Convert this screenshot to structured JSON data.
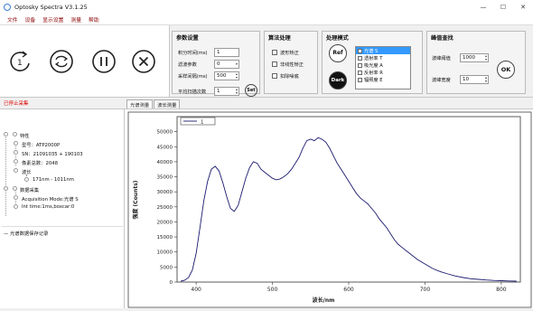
{
  "window": {
    "title": "Optosky Spectra V3.1.25",
    "minimize": "—",
    "maximize": "☐",
    "close": "✕"
  },
  "menu": [
    "文件",
    "设备",
    "显示设置",
    "测量",
    "帮助"
  ],
  "toolbar": {
    "buttons": [
      "single-measure",
      "continuous-measure",
      "pause",
      "stop"
    ]
  },
  "params": {
    "title": "参数设置",
    "integration_label": "积分时间(ms)",
    "integration_value": "1",
    "filter_label": "滤波参数",
    "filter_value": "0",
    "interval_label": "采样间隔(ms)",
    "interval_value": "500",
    "avg_label": "平均扫描次数",
    "avg_value": "1",
    "set_label": "Set"
  },
  "algo": {
    "title": "算法处理",
    "options": [
      "波形矫正",
      "非线性矫正",
      "扣除噪底"
    ]
  },
  "mode": {
    "title": "处理模式",
    "ref_label": "Ref",
    "dark_label": "Dark",
    "items": [
      "光谱 S",
      "透射率 T",
      "吸光度 A",
      "反射率 R",
      "辐照度 E"
    ]
  },
  "peak": {
    "title": "峰值查找",
    "threshold_label": "波峰阈值",
    "threshold_value": "1000",
    "width_label": "波峰宽度",
    "width_value": "10",
    "ok_label": "OK"
  },
  "status": {
    "stopped": "已停止采集"
  },
  "tree": {
    "attr": "特性",
    "model": "型号：ATP2000P",
    "sn": "SN：21091035 + 190103",
    "pixels": "像素总数：2048",
    "wavelength": "波长",
    "range": "171nm - 1011nm",
    "acq": "数据采集",
    "acq_mode": "Acquisition Mode:光谱 S",
    "int_time": "Int time:1ms,boxcar:0",
    "save": "光谱数据保存记录"
  },
  "tabs": [
    "光谱测量",
    "波长测量"
  ],
  "chart_data": {
    "type": "line",
    "legend": [
      "1"
    ],
    "xlabel": "波长/nm",
    "ylabel": "强度 (Counts)",
    "xlim": [
      375,
      825
    ],
    "ylim": [
      0,
      55000
    ],
    "xticks": [
      400,
      500,
      600,
      700,
      800
    ],
    "yticks": [
      0,
      5000,
      10000,
      15000,
      20000,
      25000,
      30000,
      35000,
      40000,
      45000,
      50000
    ],
    "series": [
      {
        "color": "#1a1a6e",
        "x": [
          380,
          385,
          390,
          395,
          400,
          405,
          410,
          415,
          420,
          425,
          430,
          435,
          440,
          445,
          450,
          455,
          460,
          465,
          470,
          475,
          480,
          485,
          490,
          495,
          500,
          505,
          510,
          515,
          520,
          525,
          530,
          535,
          540,
          545,
          550,
          555,
          560,
          565,
          570,
          575,
          580,
          585,
          590,
          595,
          600,
          605,
          610,
          615,
          620,
          625,
          630,
          635,
          640,
          645,
          650,
          655,
          660,
          665,
          670,
          675,
          680,
          690,
          700,
          710,
          720,
          730,
          740,
          750,
          760,
          770,
          780,
          790,
          800,
          810,
          820
        ],
        "y": [
          300,
          600,
          1500,
          4000,
          9500,
          18000,
          27000,
          33500,
          37500,
          38500,
          37000,
          33000,
          28500,
          24500,
          23500,
          25500,
          30000,
          34500,
          38000,
          40000,
          39500,
          37500,
          36500,
          35500,
          34500,
          34000,
          34300,
          35000,
          36000,
          37500,
          39500,
          41500,
          44500,
          47000,
          47500,
          47000,
          48000,
          47500,
          46500,
          44500,
          42000,
          39500,
          37500,
          35500,
          33500,
          31500,
          29500,
          28000,
          27000,
          26000,
          24500,
          23000,
          21000,
          19500,
          18000,
          16000,
          14000,
          12500,
          11500,
          10500,
          9500,
          7500,
          6000,
          4500,
          3500,
          2700,
          2000,
          1500,
          1100,
          900,
          700,
          550,
          450,
          350,
          300
        ]
      }
    ]
  }
}
